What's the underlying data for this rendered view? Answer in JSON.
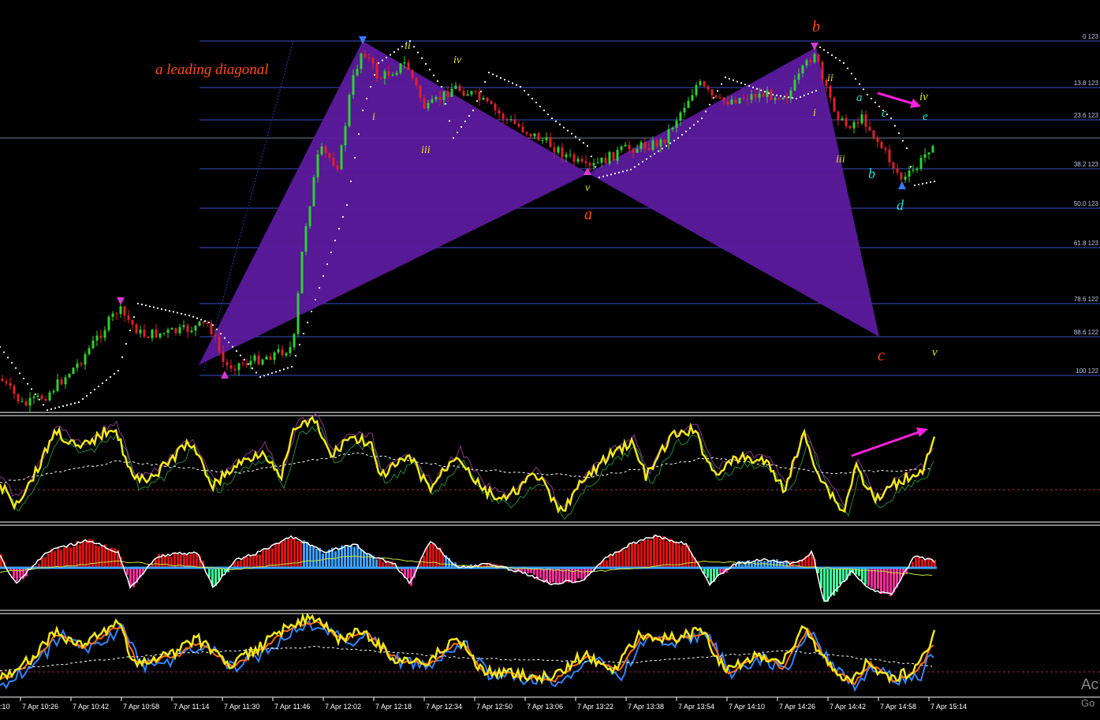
{
  "chart_data": {
    "type": "candlestick",
    "annotation_title": "a leading diagonal",
    "fib_levels": [
      {
        "label": "0 123"
      },
      {
        "label": "13.8 123"
      },
      {
        "label": "23.6 123"
      },
      {
        "label": "38.2 123"
      },
      {
        "label": "50.0 123"
      },
      {
        "label": "61.8 123"
      },
      {
        "label": "78.6 122"
      },
      {
        "label": "88.6 122"
      },
      {
        "label": "100 122"
      }
    ],
    "time_labels": [
      "7 Apr 10:26",
      "7 Apr 10:42",
      "7 Apr 10:58",
      "7 Apr 11:14",
      "7 Apr 11:30",
      "7 Apr 11:46",
      "7 Apr 12:02",
      "7 Apr 12:18",
      "7 Apr 12:34",
      "7 Apr 12:50",
      "7 Apr 13:06",
      "7 Apr 13:22",
      "7 Apr 13:38",
      "7 Apr 13:54",
      "7 Apr 14:10",
      "7 Apr 14:26",
      "7 Apr 14:42",
      "7 Apr 14:58",
      "7 Apr 15:14"
    ],
    "time_label_partial": ":10",
    "wave_labels": {
      "pattern_a": "a",
      "pattern_b": "b",
      "pattern_c": "c",
      "ii_1": "ii",
      "iv_1": "iv",
      "i_1": "i",
      "iii_1": "iii",
      "v_1": "v",
      "ii_2": "ii",
      "i_2": "i",
      "iii_2": "iii",
      "a_small": "a",
      "b_small": "b",
      "c_small": "c",
      "d_small": "d",
      "e_small": "e",
      "iv_2": "iv",
      "v_2": "v"
    },
    "colors": {
      "harmonic_fill": "#5c1a9e",
      "bull_candle": "#2ed22e",
      "bear_candle": "#e0202a",
      "fib_line": "#3b4fc9",
      "psar": "#ffffff",
      "osc_main": "#f2e81b",
      "macd_up": "#e01010",
      "macd_hist_blue": "#3ea0ff",
      "macd_hist_green": "#3dff9a",
      "macd_hist_pink": "#ff2f9a",
      "arrow": "#ff20e0",
      "label_red": "#ff4a12",
      "label_yellow": "#e8e61a",
      "label_cyan": "#27e3d8"
    }
  },
  "watermark": {
    "line1": "Ac",
    "line2": "Go"
  }
}
